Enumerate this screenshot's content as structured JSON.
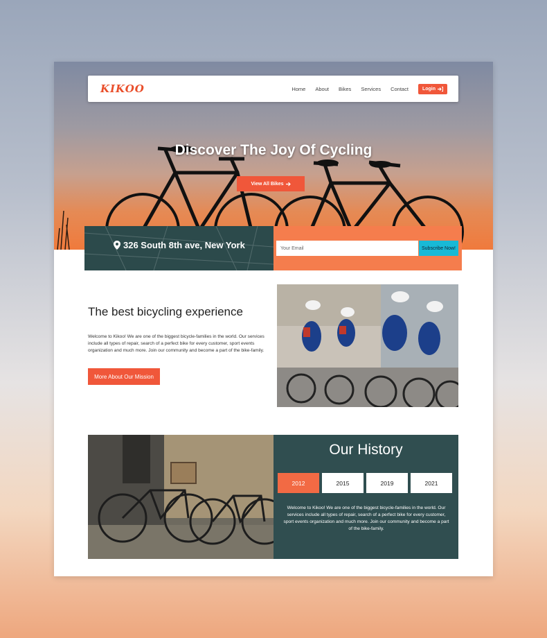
{
  "brand": {
    "logo": "KIKOO"
  },
  "nav": {
    "items": [
      "Home",
      "About",
      "Bikes",
      "Services",
      "Contact"
    ],
    "login_label": "Login"
  },
  "hero": {
    "title": "Discover The Joy Of Cycling",
    "button_label": "View All Bikes"
  },
  "address": {
    "text": "326 South 8th ave, New York"
  },
  "subscribe": {
    "placeholder": "Your Email",
    "button_label": "Subscribe Now!"
  },
  "about": {
    "title": "The best bicycling experience",
    "text": "Welcome to Kikoo! We are one of the biggest bicycle-families in the world. Our services include all types of repair, search of a perfect bike for every customer, sport events organization and much more. Join our community and become a part of the bike-family.",
    "button_label": "More About Our Mission"
  },
  "history": {
    "title": "Our History",
    "years": [
      {
        "label": "2012",
        "active": true
      },
      {
        "label": "2015",
        "active": false
      },
      {
        "label": "2019",
        "active": false
      },
      {
        "label": "2021",
        "active": false
      }
    ],
    "text": "Welcome to Kikoo! We are one of the biggest bicycle-families in the world. Our services include all types of repair, search of a perfect bike for every customer, sport events organization and much more. Join our community and become a part of the bike-family."
  },
  "colors": {
    "accent": "#f0573a",
    "dark_teal": "#2c4a4b",
    "subscribe_bg": "#f57d4d",
    "subscribe_button": "#18b9d6"
  },
  "icons": {
    "map_pin": "map-pin-icon",
    "login": "login-icon",
    "arrow": "arrow-right-icon"
  }
}
